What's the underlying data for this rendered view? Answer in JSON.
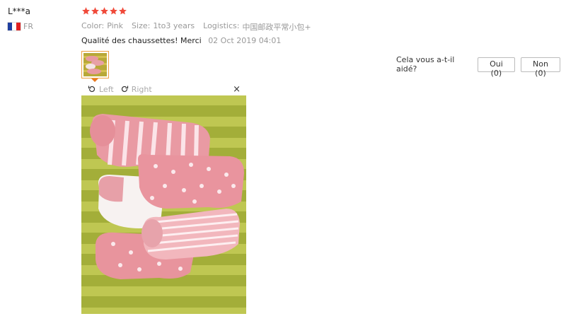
{
  "reviewer": {
    "name": "L***a",
    "country_code": "FR",
    "flag_colors": [
      "#1f3fa0",
      "#ffffff",
      "#e02020"
    ]
  },
  "rating": {
    "stars": 5,
    "max": 5,
    "color": "#f04a3a"
  },
  "attributes": {
    "color_label": "Color:",
    "color_value": "Pink",
    "size_label": "Size:",
    "size_value": "1to3 years",
    "logistics_label": "Logistics:",
    "logistics_value": "中国邮政平常小包+"
  },
  "review": {
    "text": "Qualité des chaussettes! Merci",
    "date": "02 Oct 2019 04:01"
  },
  "helpful": {
    "question": "Cela vous a-t-il aidé?",
    "yes_label": "Oui (0)",
    "no_label": "Non (0)"
  },
  "viewer": {
    "rotate_left_label": "Left",
    "rotate_right_label": "Right",
    "close_glyph": "×"
  },
  "colors": {
    "accent": "#e87a20",
    "muted_text": "#999999"
  }
}
